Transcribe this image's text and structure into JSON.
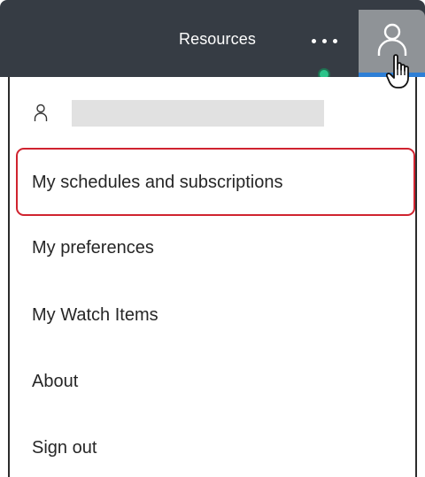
{
  "header": {
    "resources_label": "Resources",
    "icons": {
      "more": "more-horizontal-icon",
      "status": "status-dot-icon",
      "user": "user-icon",
      "cursor": "hand-pointer-icon"
    },
    "colors": {
      "bar": "#363c44",
      "user_button_active": "#8f9397",
      "underline": "#2e7fd6",
      "status_dot": "#2bc48a"
    }
  },
  "menu": {
    "items": [
      {
        "label": "My schedules and subscriptions",
        "highlighted": true
      },
      {
        "label": "My preferences"
      },
      {
        "label": "My Watch Items"
      },
      {
        "label": "About"
      },
      {
        "label": "Sign out"
      }
    ],
    "highlight_color": "#d0232f"
  }
}
